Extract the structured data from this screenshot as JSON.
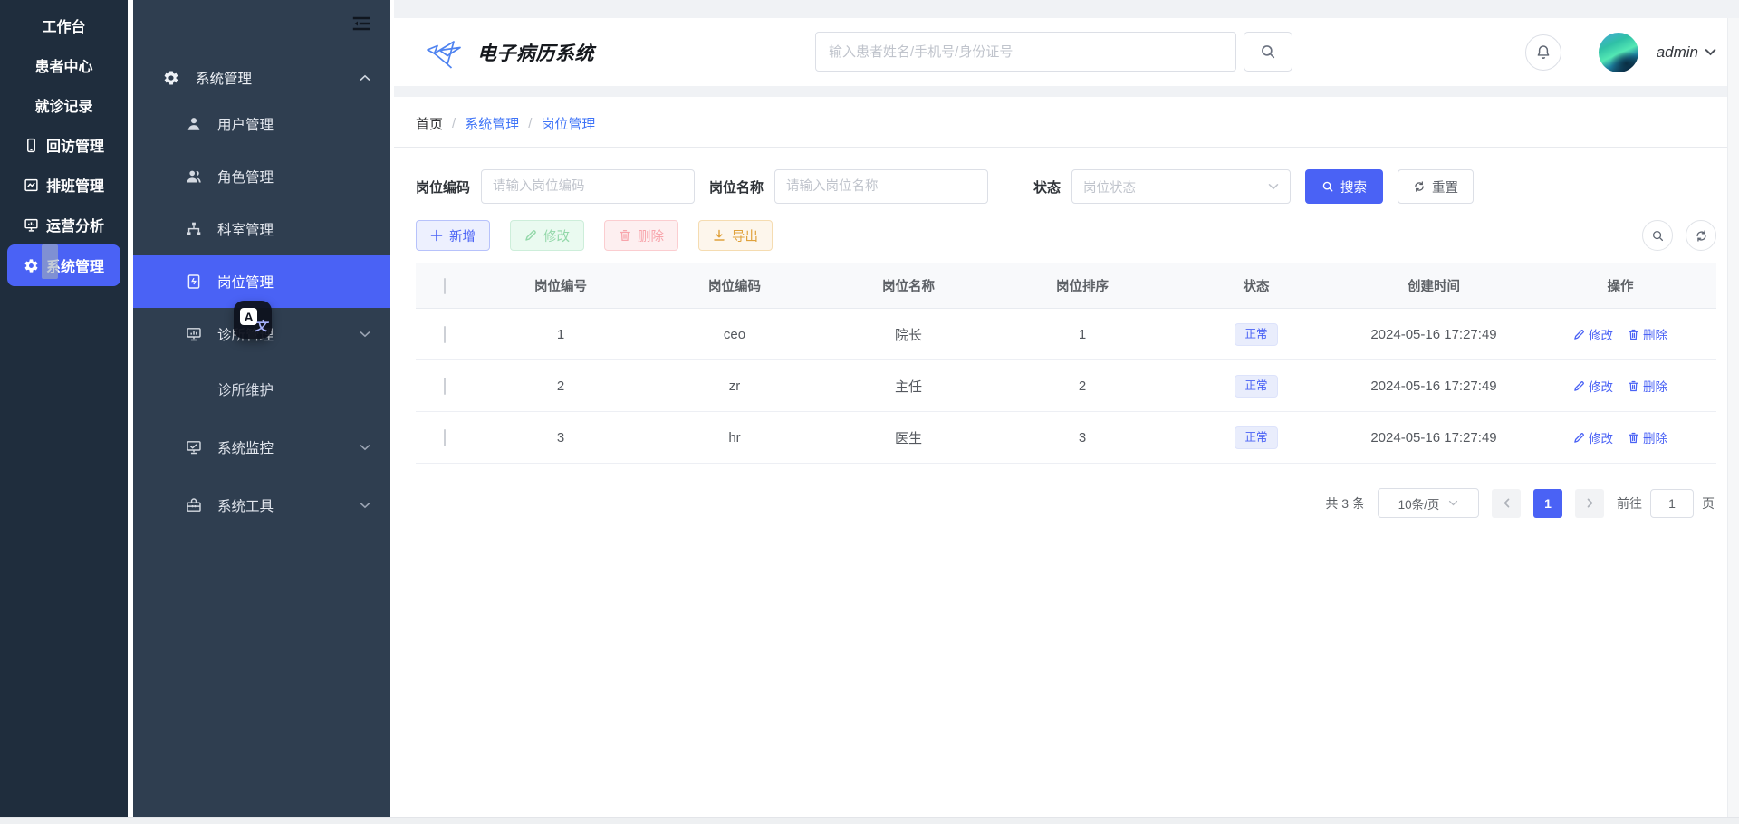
{
  "app_title": "电子病历系统",
  "colors": {
    "primary": "#4a62f5",
    "sidebar_dark": "#1f2d3d",
    "sidebar_mid": "#2f3e50",
    "breadcrumb_link": "#3e73f7",
    "warning": "#e0a23c"
  },
  "primary_sidebar": {
    "items": [
      {
        "label": "工作台"
      },
      {
        "label": "患者中心"
      },
      {
        "label": "就诊记录"
      },
      {
        "label": "回访管理"
      },
      {
        "label": "排班管理"
      },
      {
        "label": "运营分析"
      },
      {
        "label": "系统管理"
      }
    ]
  },
  "secondary_sidebar": {
    "group_label": "系统管理",
    "items": [
      {
        "label": "用户管理"
      },
      {
        "label": "角色管理"
      },
      {
        "label": "科室管理"
      },
      {
        "label": "岗位管理"
      },
      {
        "label": "诊所管理"
      },
      {
        "label": "诊所维护"
      },
      {
        "label": "系统监控"
      },
      {
        "label": "系统工具"
      }
    ]
  },
  "header": {
    "search_placeholder": "输入患者姓名/手机号/身份证号",
    "username": "admin"
  },
  "breadcrumb": {
    "items": [
      "首页",
      "系统管理",
      "岗位管理"
    ]
  },
  "filters": {
    "code_label": "岗位编码",
    "code_placeholder": "请输入岗位编码",
    "name_label": "岗位名称",
    "name_placeholder": "请输入岗位名称",
    "status_label": "状态",
    "status_placeholder": "岗位状态",
    "search_label": "搜索",
    "reset_label": "重置"
  },
  "toolbar": {
    "add": "新增",
    "edit": "修改",
    "delete": "删除",
    "export": "导出"
  },
  "table": {
    "headers": [
      "岗位编号",
      "岗位编码",
      "岗位名称",
      "岗位排序",
      "状态",
      "创建时间",
      "操作"
    ],
    "rows": [
      {
        "id": "1",
        "code": "ceo",
        "name": "院长",
        "sort": "1",
        "status": "正常",
        "created": "2024-05-16 17:27:49"
      },
      {
        "id": "2",
        "code": "zr",
        "name": "主任",
        "sort": "2",
        "status": "正常",
        "created": "2024-05-16 17:27:49"
      },
      {
        "id": "3",
        "code": "hr",
        "name": "医生",
        "sort": "3",
        "status": "正常",
        "created": "2024-05-16 17:27:49"
      }
    ],
    "actions": {
      "edit": "修改",
      "delete": "删除"
    }
  },
  "pagination": {
    "total_text": "共 3 条",
    "page_size": "10条/页",
    "current_page": "1",
    "goto_label": "前往",
    "goto_value": "1",
    "page_suffix": "页"
  },
  "translate_fab": {
    "letter": "A",
    "glyph": "文"
  }
}
